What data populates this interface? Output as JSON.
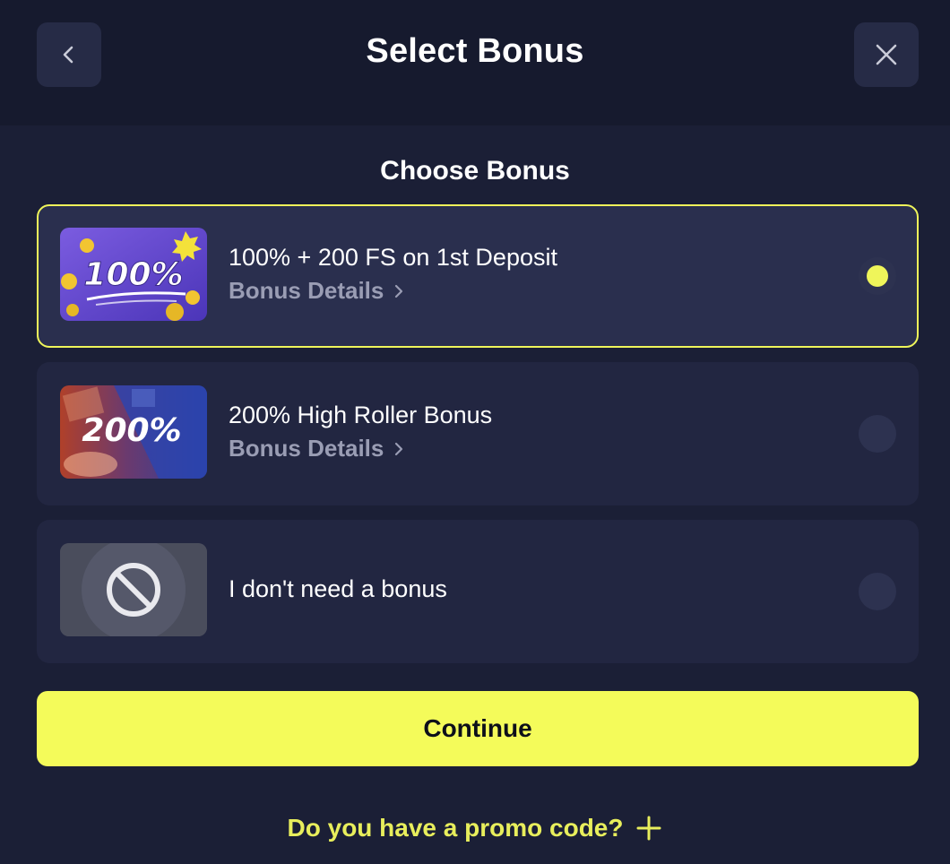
{
  "header": {
    "title": "Select Bonus",
    "back_icon": "chevron-left-icon",
    "close_icon": "close-icon"
  },
  "section": {
    "title": "Choose Bonus"
  },
  "bonuses": [
    {
      "title": "100% + 200 FS on 1st Deposit",
      "details_label": "Bonus Details",
      "badge_text": "100%",
      "selected": true
    },
    {
      "title": "200% High Roller Bonus",
      "details_label": "Bonus Details",
      "badge_text": "200%",
      "selected": false
    },
    {
      "title": "I don't need a bonus",
      "selected": false
    }
  ],
  "continue_label": "Continue",
  "promo_label": "Do you have a promo code?",
  "colors": {
    "accent": "#f4fb5a",
    "background": "#1b1f36",
    "card": "#222641",
    "muted": "#9a9db4"
  }
}
